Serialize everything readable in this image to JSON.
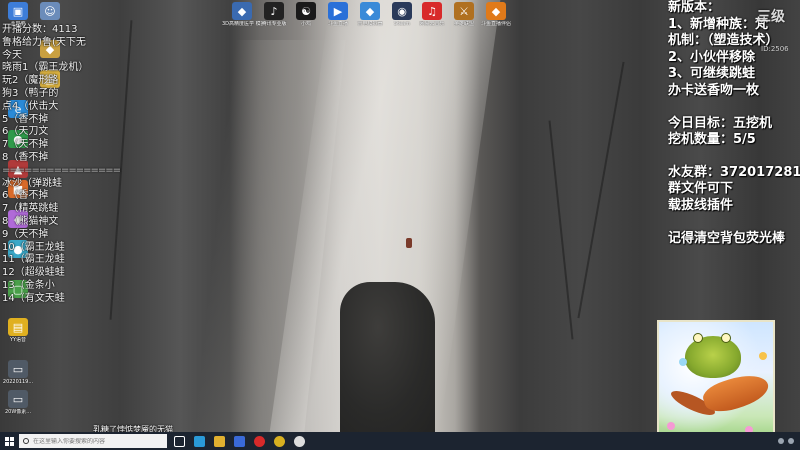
{
  "desktop_icons": [
    {
      "name": "recycle-bin-icon",
      "label": "此电脑",
      "color": "#3d7dd8",
      "glyph": "▣"
    },
    {
      "name": "user-icon",
      "label": "",
      "color": "#6b8cba",
      "glyph": "☺"
    },
    {
      "name": "app-icon",
      "label": "",
      "color": "#c9a040",
      "glyph": "◆"
    },
    {
      "name": "folder-icon",
      "label": "",
      "color": "#d8b040",
      "glyph": "▤"
    },
    {
      "name": "edge-icon",
      "label": "",
      "color": "#2a8ad8",
      "glyph": "e"
    },
    {
      "name": "app-icon",
      "label": "",
      "color": "#2f9a4a",
      "glyph": "●"
    },
    {
      "name": "app-icon",
      "label": "",
      "color": "#b03a3a",
      "glyph": "▲"
    },
    {
      "name": "app-icon",
      "label": "",
      "color": "#d86a2a",
      "glyph": "■"
    },
    {
      "name": "app-icon",
      "label": "",
      "color": "#b06ad8",
      "glyph": "◆"
    },
    {
      "name": "app-icon",
      "label": "",
      "color": "#3aa8c8",
      "glyph": "●"
    },
    {
      "name": "app-icon",
      "label": "",
      "color": "#4aa04a",
      "glyph": "▢"
    },
    {
      "name": "folder-icon",
      "label": "YY语音",
      "color": "#e0b020",
      "glyph": "▤"
    },
    {
      "name": "file-icon",
      "label": "20220119...",
      "color": "#505a66",
      "glyph": "▭"
    },
    {
      "name": "file-icon",
      "label": "20W像素...",
      "color": "#505a66",
      "glyph": "▭"
    }
  ],
  "top_icons": [
    {
      "name": "app-icon",
      "label": "3D高精度医学\n模拟",
      "color": "#3a6ab0",
      "glyph": "◆"
    },
    {
      "name": "app-icon",
      "label": "腾讯专业版",
      "color": "#222222",
      "glyph": "♪"
    },
    {
      "name": "app-icon",
      "label": "小鸡",
      "color": "#1a1a1a",
      "glyph": "☯"
    },
    {
      "name": "app-icon",
      "label": "斗鱼直播",
      "color": "#2a70d8",
      "glyph": "▶"
    },
    {
      "name": "app-icon",
      "label": "雷电模拟器",
      "color": "#3a8ad8",
      "glyph": "◆"
    },
    {
      "name": "app-icon",
      "label": "Steam",
      "color": "#2a3a5a",
      "glyph": "◉"
    },
    {
      "name": "app-icon",
      "label": "网易云音乐",
      "color": "#d82a2a",
      "glyph": "♫"
    },
    {
      "name": "app-icon",
      "label": "英雄联盟",
      "color": "#b07020",
      "glyph": "⚔"
    },
    {
      "name": "app-icon",
      "label": "斗鱼直播伴侣",
      "color": "#e07a1a",
      "glyph": "◆"
    }
  ],
  "left_overlay": {
    "lines": [
      "开播分数：4113",
      "鲁格给力鲁(天下无",
      "今天",
      "晓雨1（霸王龙机）",
      "玩2（魔形路",
      "狗3（鸭子的",
      "点4（伏击大",
      "5（香不掉",
      "6（天刀文",
      "7（天不掉",
      "8（香不掉",
      "================",
      "冰沙（弹跳蛙",
      "6（香不掉",
      "7（精英跳蛙",
      "8（熊猫神文",
      "9（天不掉",
      "10（霸王龙蛙",
      "11（霸王龙蛙",
      "12（超级蛙蛙",
      "13（金条小",
      "14（有文天蛙"
    ]
  },
  "right_overlay": {
    "block1": [
      "新版本：",
      "1、新增种族：梵",
      "机制：（塑造技术）",
      "2、小伙伴移除",
      "3、可继续跳蛙",
      "办卡送香吻一枚"
    ],
    "block2": [
      "今日目标：五挖机",
      "挖机数量：5/5"
    ],
    "block3": [
      "水友群：372017281",
      "群文件可下",
      "载拔线插件"
    ],
    "block4": [
      "记得清空背包荧光棒"
    ]
  },
  "watermark": {
    "main": "三级",
    "sub": "ID:2506"
  },
  "ticker": {
    "text": "乳糖了悖惦梦魇的无猫"
  },
  "taskbar": {
    "search_placeholder": "在这里输入你要搜索的内容",
    "apps": [
      {
        "name": "task-view-icon",
        "color": "#ffffff"
      },
      {
        "name": "edge-browser-icon",
        "color": "#2a9ad8"
      },
      {
        "name": "file-explorer-icon",
        "color": "#e0b030"
      },
      {
        "name": "store-icon",
        "color": "#3a6ad8"
      },
      {
        "name": "netease-music-icon",
        "color": "#d82a2a"
      },
      {
        "name": "chrome-icon",
        "color": "#d8b020"
      },
      {
        "name": "obs-icon",
        "color": "#dddddd"
      }
    ]
  }
}
